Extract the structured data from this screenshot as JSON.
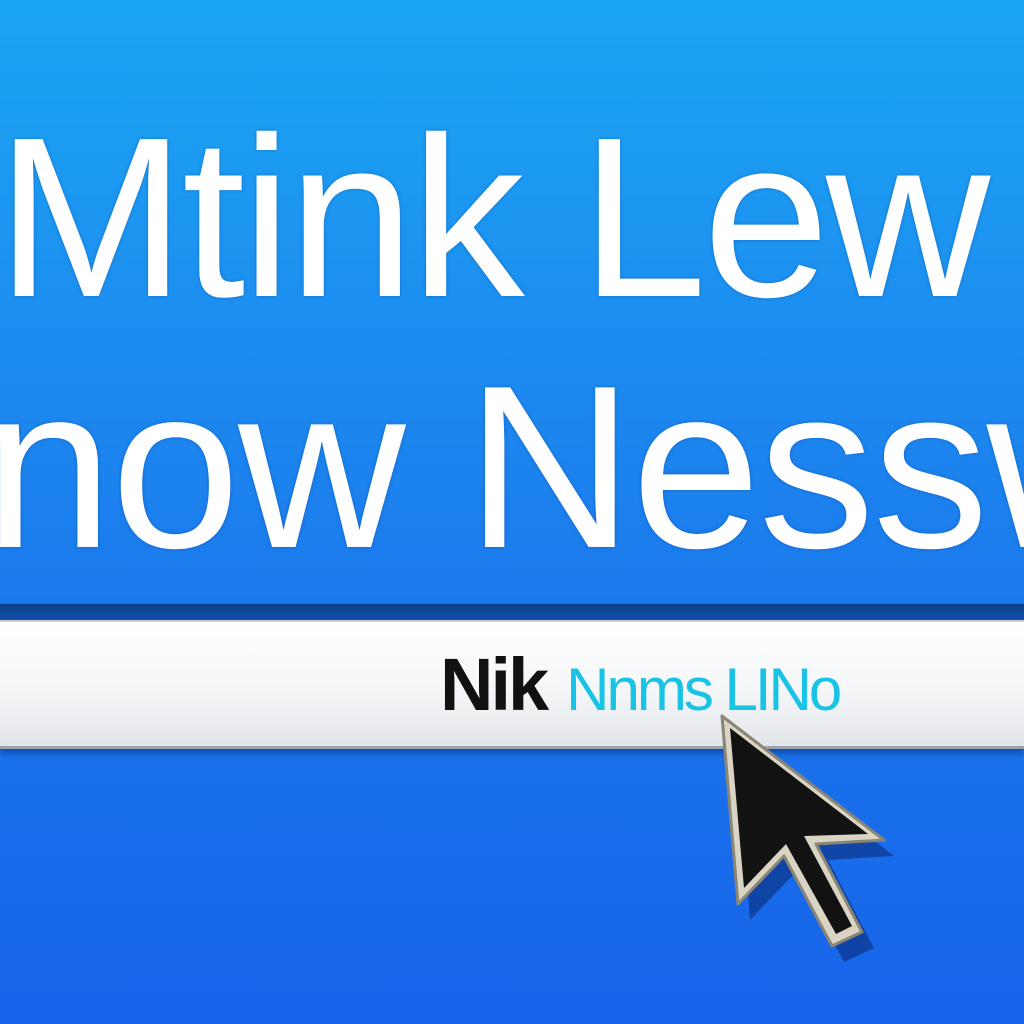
{
  "headline": {
    "line1": "Mtink Lew",
    "line2": "now Nessw"
  },
  "address_bar": {
    "brand_dark": "Nik",
    "brand_accent": "Nnms LINo"
  },
  "cursor": {
    "icon": "pointer-arrow-icon"
  },
  "colors": {
    "background_top": "#1aa6f2",
    "background_bottom": "#1763ea",
    "headline_text": "#ffffff",
    "brand_dark": "#111111",
    "brand_accent": "#19c3e6"
  }
}
